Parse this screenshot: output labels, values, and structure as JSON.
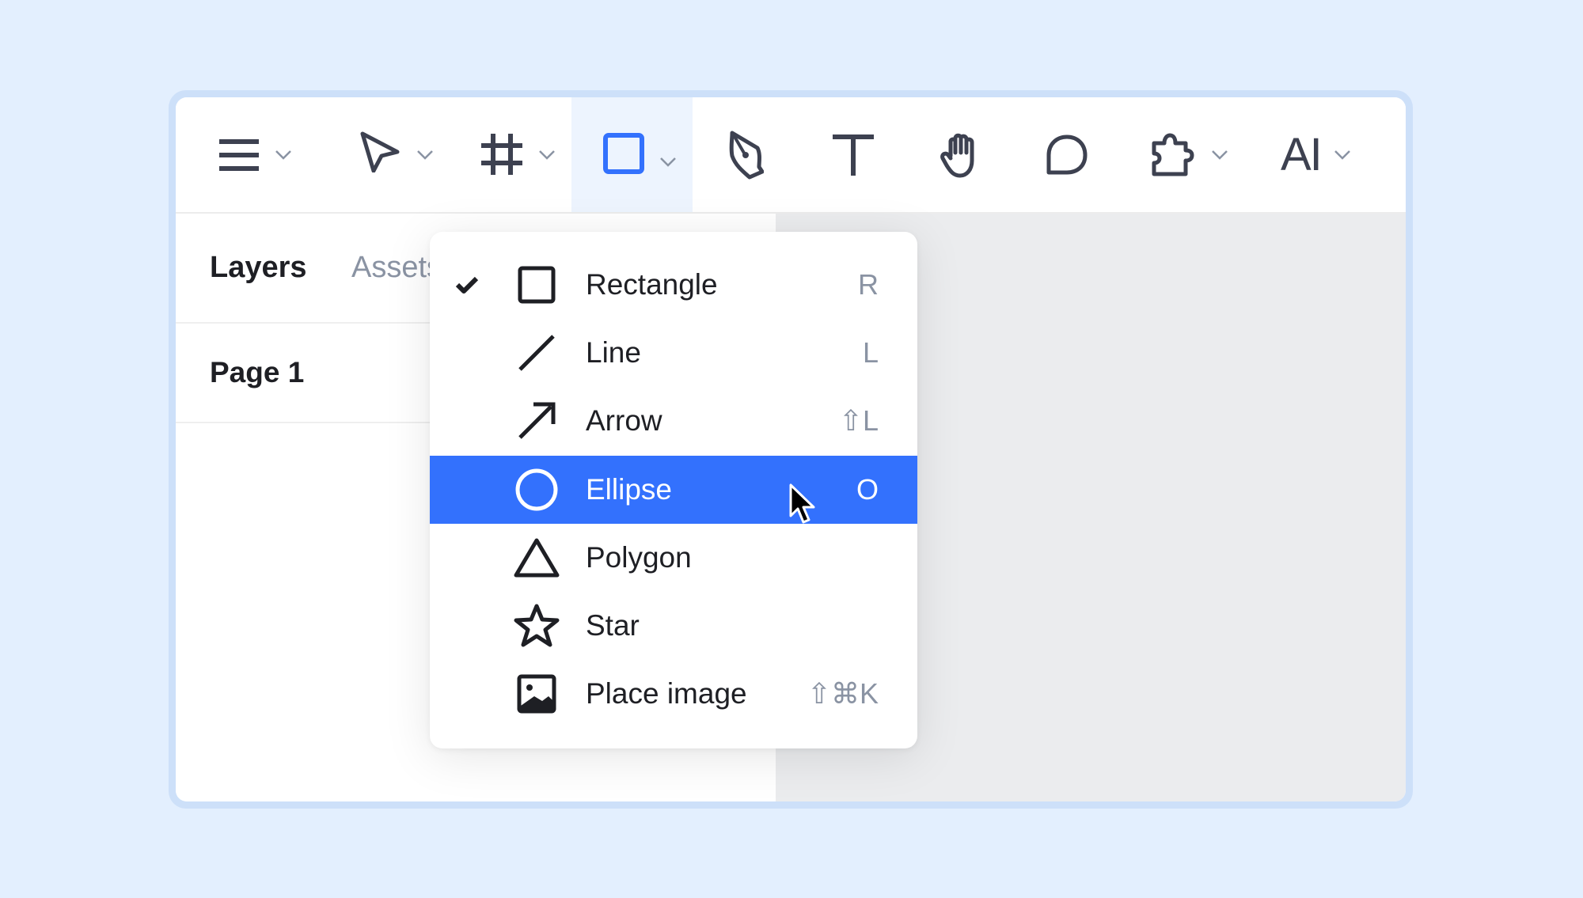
{
  "toolbar": {
    "tools": [
      {
        "name": "main-menu",
        "icon": "hamburger-menu-icon",
        "has_dropdown": true
      },
      {
        "name": "move",
        "icon": "pointer-arrow-icon",
        "has_dropdown": true
      },
      {
        "name": "frame",
        "icon": "frame-hash-icon",
        "has_dropdown": true
      },
      {
        "name": "shape",
        "icon": "rectangle-icon",
        "has_dropdown": true,
        "active": true
      },
      {
        "name": "pen",
        "icon": "pen-nib-icon",
        "has_dropdown": false
      },
      {
        "name": "text",
        "icon": "text-t-icon",
        "has_dropdown": false
      },
      {
        "name": "hand",
        "icon": "hand-icon",
        "has_dropdown": false
      },
      {
        "name": "comment",
        "icon": "comment-bubble-icon",
        "has_dropdown": false
      },
      {
        "name": "plugins",
        "icon": "puzzle-piece-icon",
        "has_dropdown": true
      },
      {
        "name": "ai",
        "label": "AI",
        "has_dropdown": true
      }
    ],
    "ai_label": "AI"
  },
  "left_panel": {
    "tabs": [
      {
        "label": "Layers",
        "active": true
      },
      {
        "label": "Assets",
        "active": false
      }
    ],
    "page_label": "Page 1"
  },
  "shape_menu": {
    "items": [
      {
        "label": "Rectangle",
        "icon": "rectangle-icon",
        "shortcut": "R",
        "checked": true,
        "highlighted": false
      },
      {
        "label": "Line",
        "icon": "line-icon",
        "shortcut": "L",
        "checked": false,
        "highlighted": false
      },
      {
        "label": "Arrow",
        "icon": "arrow-icon",
        "shortcut": "⇧L",
        "checked": false,
        "highlighted": false
      },
      {
        "label": "Ellipse",
        "icon": "ellipse-icon",
        "shortcut": "O",
        "checked": false,
        "highlighted": true
      },
      {
        "label": "Polygon",
        "icon": "triangle-polygon-icon",
        "shortcut": "",
        "checked": false,
        "highlighted": false
      },
      {
        "label": "Star",
        "icon": "star-icon",
        "shortcut": "",
        "checked": false,
        "highlighted": false
      },
      {
        "label": "Place image",
        "icon": "image-icon",
        "shortcut": "⇧⌘K",
        "checked": false,
        "highlighted": false
      }
    ]
  },
  "colors": {
    "accent": "#3371fd",
    "background": "#e3effe",
    "frame_border": "#cde0f9",
    "canvas": "#ebecee",
    "icon_dark": "#3d4150",
    "muted_text": "#8a93a3"
  }
}
